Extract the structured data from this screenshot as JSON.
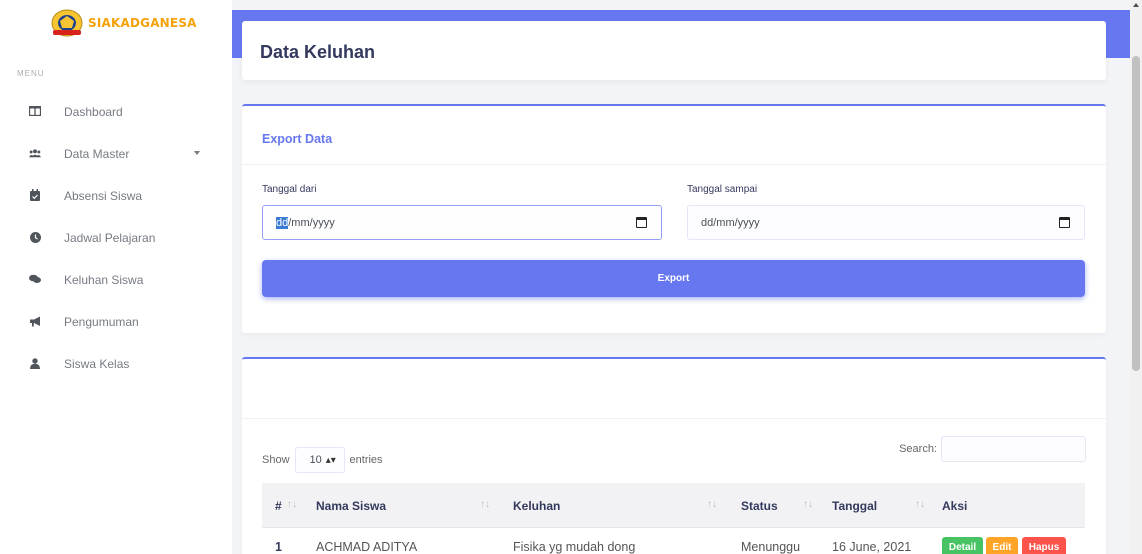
{
  "brand": {
    "name": "SIAKADGANESA"
  },
  "sidebar": {
    "heading": "MENU",
    "items": [
      {
        "label": "Dashboard",
        "icon": "columns-icon"
      },
      {
        "label": "Data Master",
        "icon": "users-icon",
        "has_dropdown": true
      },
      {
        "label": "Absensi Siswa",
        "icon": "calendar-check-icon"
      },
      {
        "label": "Jadwal Pelajaran",
        "icon": "clock-icon"
      },
      {
        "label": "Keluhan Siswa",
        "icon": "comments-icon"
      },
      {
        "label": "Pengumuman",
        "icon": "bullhorn-icon"
      },
      {
        "label": "Siswa Kelas",
        "icon": "user-icon"
      }
    ]
  },
  "page": {
    "title": "Data Keluhan"
  },
  "export": {
    "title": "Export Data",
    "from_label": "Tanggal dari",
    "from_value_selected": "dd",
    "from_value_rest": "/mm/yyyy",
    "to_label": "Tanggal sampai",
    "to_value": "dd/mm/yyyy",
    "button_label": "Export"
  },
  "table": {
    "show_label": "Show",
    "entries_value": "10",
    "entries_label": "entries",
    "search_label": "Search:",
    "columns": [
      "#",
      "Nama Siswa",
      "Keluhan",
      "Status",
      "Tanggal",
      "Aksi"
    ],
    "rows": [
      {
        "no": "1",
        "nama": "ACHMAD ADITYA",
        "keluhan": "Fisika yg mudah dong",
        "status": "Menunggu",
        "tanggal": "16 June, 2021",
        "actions": [
          "Detail",
          "Edit",
          "Hapus"
        ]
      }
    ]
  },
  "colors": {
    "primary": "#6777ef",
    "detail": "#47c363",
    "edit": "#ffa426",
    "hapus": "#fc544b",
    "brand_text": "#f5a20a"
  }
}
